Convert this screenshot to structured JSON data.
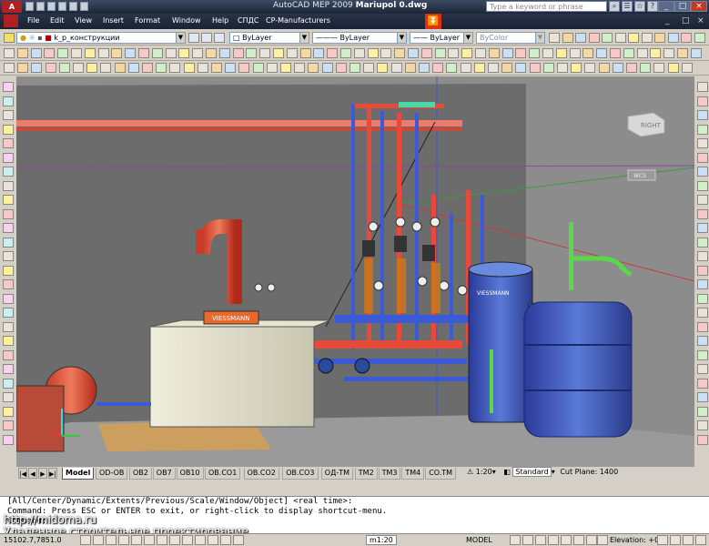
{
  "app": {
    "logo": "A",
    "title_app": "AutoCAD MEP 2009",
    "title_file": "Mariupol 0.dwg",
    "search_placeholder": "Type a keyword or phrase"
  },
  "menu": {
    "items": [
      "File",
      "Edit",
      "View",
      "Insert",
      "Format",
      "Window",
      "Help",
      "СПДС",
      "CP-Manufacturers"
    ],
    "window_controls": [
      "_",
      "□",
      "×"
    ],
    "doc_controls": [
      "_",
      "□",
      "×"
    ]
  },
  "toolbar": {
    "layer_value": "k_p_конструкции",
    "color_value": "ByLayer",
    "linetype_value": "ByLayer",
    "lineweight_value": "ByLayer",
    "plotstyle_value": "ByColor"
  },
  "viewcube": {
    "face": "RIGHT",
    "wcs": "WCS"
  },
  "equipment_labels": {
    "boiler": "VIESSMANN",
    "tank": "VIESSMANN"
  },
  "layout_tabs": {
    "active": "Model",
    "items": [
      "Model",
      "OD-OB",
      "OB2",
      "OB7",
      "OB10",
      "OB.CO1",
      "OB.CO2",
      "OB.CO3",
      "ОД-ТМ",
      "TM2",
      "TM3",
      "TM4",
      "CO.TM"
    ]
  },
  "viewport_bar": {
    "scale": "1:20",
    "style": "Standard",
    "cut_plane": "Cut Plane: 1400"
  },
  "command": {
    "line1": "[All/Center/Dynamic/Extents/Previous/Scale/Window/Object] <real time>:",
    "line2": "Command: Press ESC or ENTER to exit, or right-click to display shortcut-menu.",
    "line3": "Command:"
  },
  "watermark": {
    "url": "http://midoma.ru",
    "caption": "Удаленное строительное проектирование"
  },
  "status": {
    "coords": "15102.7,7851.0",
    "scale": "m1:20",
    "space": "MODEL",
    "elevation": "Elevation: +0"
  },
  "colors": {
    "viewport_bg": "#8a8a8a",
    "hot_pipe": "#e84a3a",
    "cold_pipe": "#3a5ad8",
    "green_pipe": "#5ad84a",
    "titlebar": "#1c2638"
  }
}
